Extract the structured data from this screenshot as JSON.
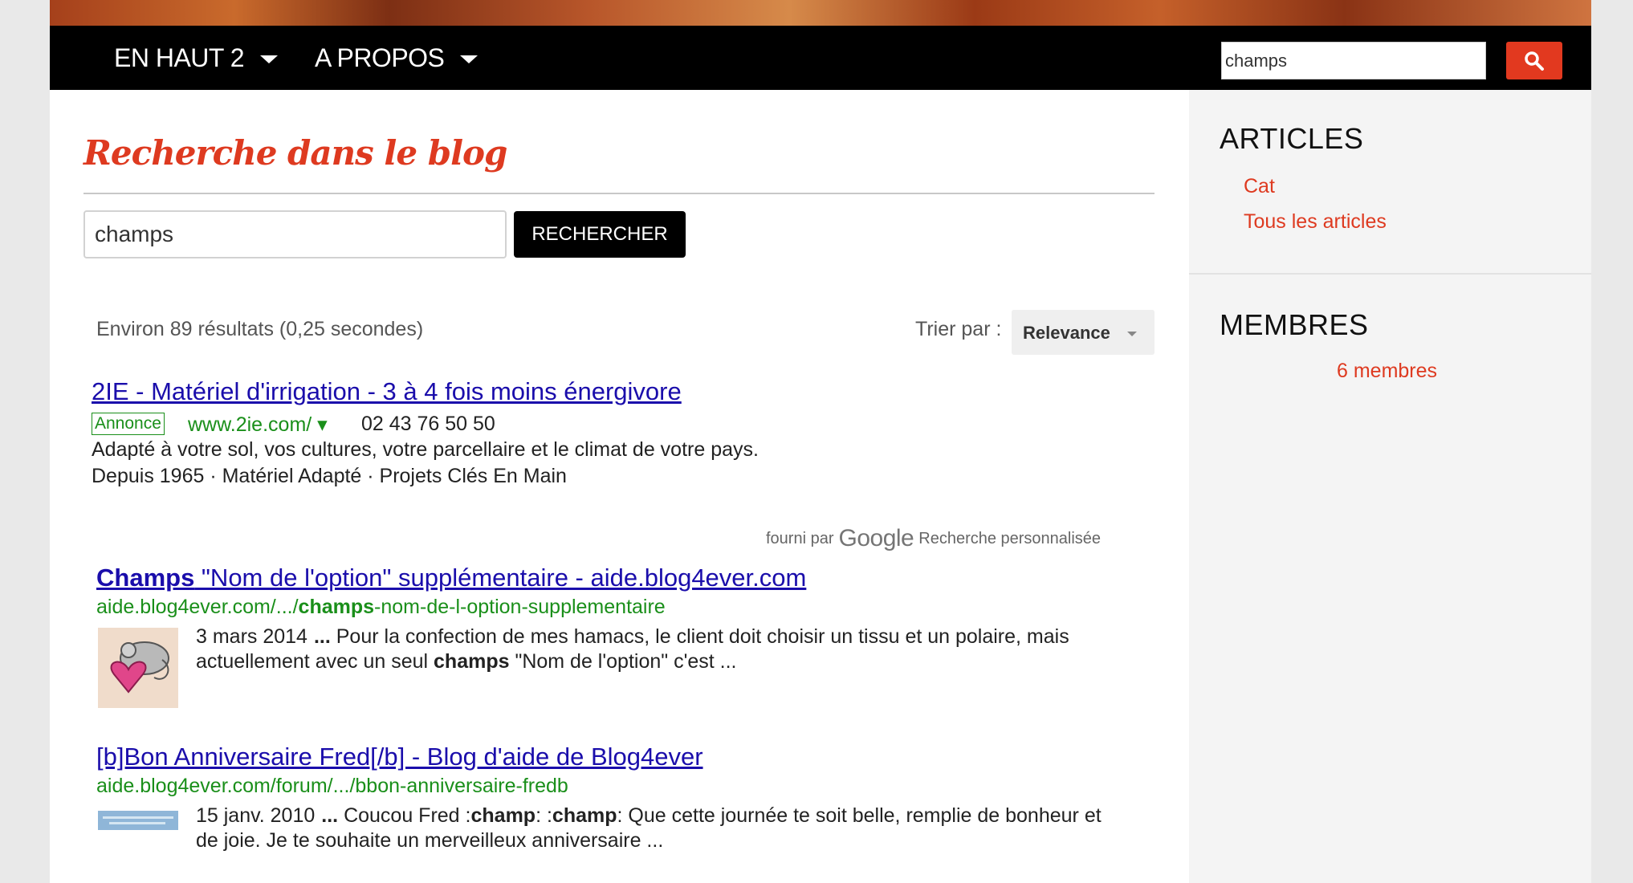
{
  "nav": {
    "items": [
      {
        "label": "EN HAUT 2"
      },
      {
        "label": "A PROPOS"
      }
    ],
    "search_value": "champs"
  },
  "main": {
    "title": "Recherche dans le blog",
    "search_value": "champs",
    "search_button": "RECHERCHER",
    "result_count": "Environ 89 résultats (0,25 secondes)",
    "sort_label": "Trier par :",
    "sort_value": "Relevance"
  },
  "ad": {
    "title": "2IE - Matériel d'irrigation - 3 à 4 fois moins énergivore",
    "badge": "Annonce",
    "url": "www.2ie.com/ ▾",
    "phone": "02 43 76 50 50",
    "line1": "Adapté à votre sol, vos cultures, votre parcellaire et le climat de votre pays.",
    "line2": "Depuis 1965 · Matériel Adapté · Projets Clés En Main"
  },
  "powered": {
    "prefix": "fourni par",
    "brand": "Google",
    "suffix": "Recherche personnalisée"
  },
  "results": [
    {
      "title_bold": "Champs",
      "title_rest": " \"Nom de l'option\" supplémentaire - aide.blog4ever.com",
      "url_pre": "aide.blog4ever.com/.../",
      "url_bold": "champs",
      "url_post": "-nom-de-l-option-supplementaire",
      "date": "3 mars 2014",
      "snip_a": " Pour la confection de mes hamacs, le client doit choisir un tissu et un polaire, mais actuellement avec un seul ",
      "snip_bold": "champs",
      "snip_b": " \"Nom de l'option\" c'est ..."
    },
    {
      "title": "[b]Bon Anniversaire Fred[/b] - Blog d'aide de Blog4ever",
      "url": "aide.blog4ever.com/forum/.../bbon-anniversaire-fredb",
      "date": "15 janv. 2010",
      "snip_a": " Coucou Fred :",
      "snip_bold1": "champ",
      "snip_mid": ": :",
      "snip_bold2": "champ",
      "snip_b": ": Que cette journée te soit belle, remplie de bonheur et de joie. Je te souhaite un merveilleux anniversaire ..."
    }
  ],
  "ellipsis": "...",
  "sidebar": {
    "articles_heading": "ARTICLES",
    "article_links": [
      "Cat",
      "Tous les articles"
    ],
    "members_heading": "MEMBRES",
    "members_link": "6 membres"
  },
  "colors": {
    "accent": "#de3a20",
    "link": "#1a0dab",
    "url_green": "#1a8f1a",
    "nav_bg": "#000000"
  }
}
